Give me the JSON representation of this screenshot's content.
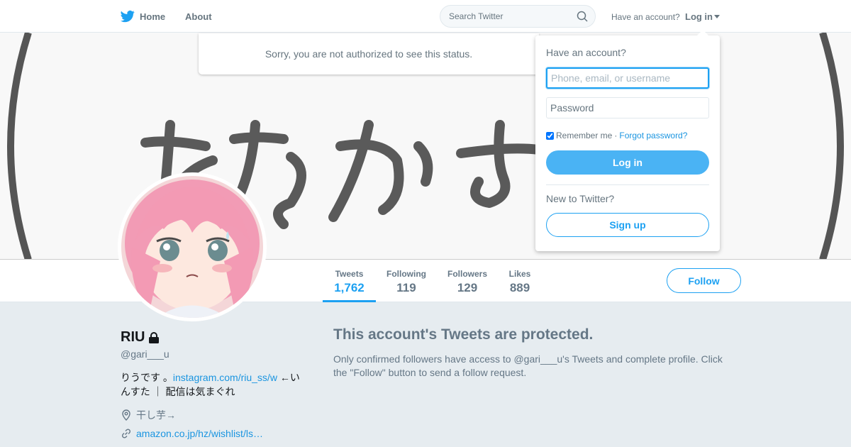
{
  "nav": {
    "home_label": "Home",
    "about_label": "About",
    "search_placeholder": "Search Twitter",
    "have_account": "Have an account?",
    "login_label": "Log in"
  },
  "notice": "Sorry, you are not authorized to see this status.",
  "stats": [
    {
      "label": "Tweets",
      "value": "1,762"
    },
    {
      "label": "Following",
      "value": "119"
    },
    {
      "label": "Followers",
      "value": "129"
    },
    {
      "label": "Likes",
      "value": "889"
    }
  ],
  "follow_label": "Follow",
  "profile": {
    "name": "RIU",
    "handle": "@gari___u",
    "bio_prefix": "りうです 。",
    "bio_link": "instagram.com/riu_ss/w",
    "bio_suffix": " ←いんすた ｜ 配信は気まぐれ",
    "location": "干し芋→",
    "url": "amazon.co.jp/hz/wishlist/ls…"
  },
  "protected": {
    "title": "This account's Tweets are protected.",
    "text": "Only confirmed followers have access to @gari___u's Tweets and complete profile. Click the \"Follow\" button to send a follow request."
  },
  "login_dropdown": {
    "heading": "Have an account?",
    "username_placeholder": "Phone, email, or username",
    "password_placeholder": "Password",
    "remember_label": "Remember me",
    "separator": " · ",
    "forgot_label": "Forgot password?",
    "login_button": "Log in",
    "new_to": "New to Twitter?",
    "signup_button": "Sign up"
  },
  "colors": {
    "accent": "#1da1f2",
    "login_button_bg": "#4ab3f4",
    "page_bg": "#e6ecf0"
  }
}
